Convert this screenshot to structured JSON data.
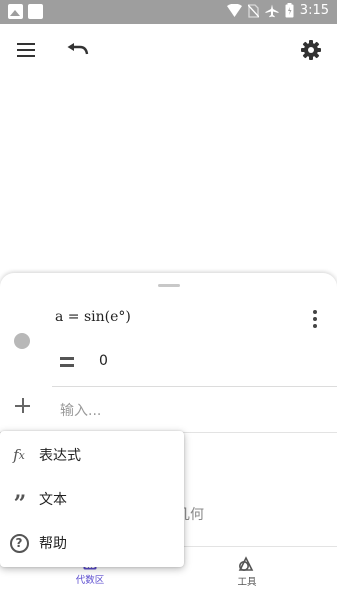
{
  "status_bar": {
    "time": "3:15",
    "left_icons": [
      "image-notification-icon",
      "square-notification-icon"
    ],
    "right_icons": [
      "wifi-icon",
      "no-sim-icon",
      "airplane-mode-icon",
      "battery-icon"
    ]
  },
  "toolbar": {
    "menu_icon": "menu-icon",
    "undo_icon": "undo-icon",
    "settings_icon": "gear-icon"
  },
  "algebra": {
    "items": [
      {
        "expression": "a = sin(e°)",
        "result": "0"
      }
    ],
    "input_placeholder": "输入..."
  },
  "background_label": "几何",
  "add_menu": {
    "items": [
      {
        "icon": "fx-icon",
        "label": "表达式"
      },
      {
        "icon": "quote-icon",
        "label": "文本"
      },
      {
        "icon": "help-icon",
        "label": "帮助"
      }
    ]
  },
  "bottom_nav": {
    "tabs": [
      {
        "label": "代数区",
        "icon": "calculator-icon",
        "active": true
      },
      {
        "label": "工具",
        "icon": "tools-icon",
        "active": false
      }
    ],
    "active_color": "#5b4ccf"
  }
}
